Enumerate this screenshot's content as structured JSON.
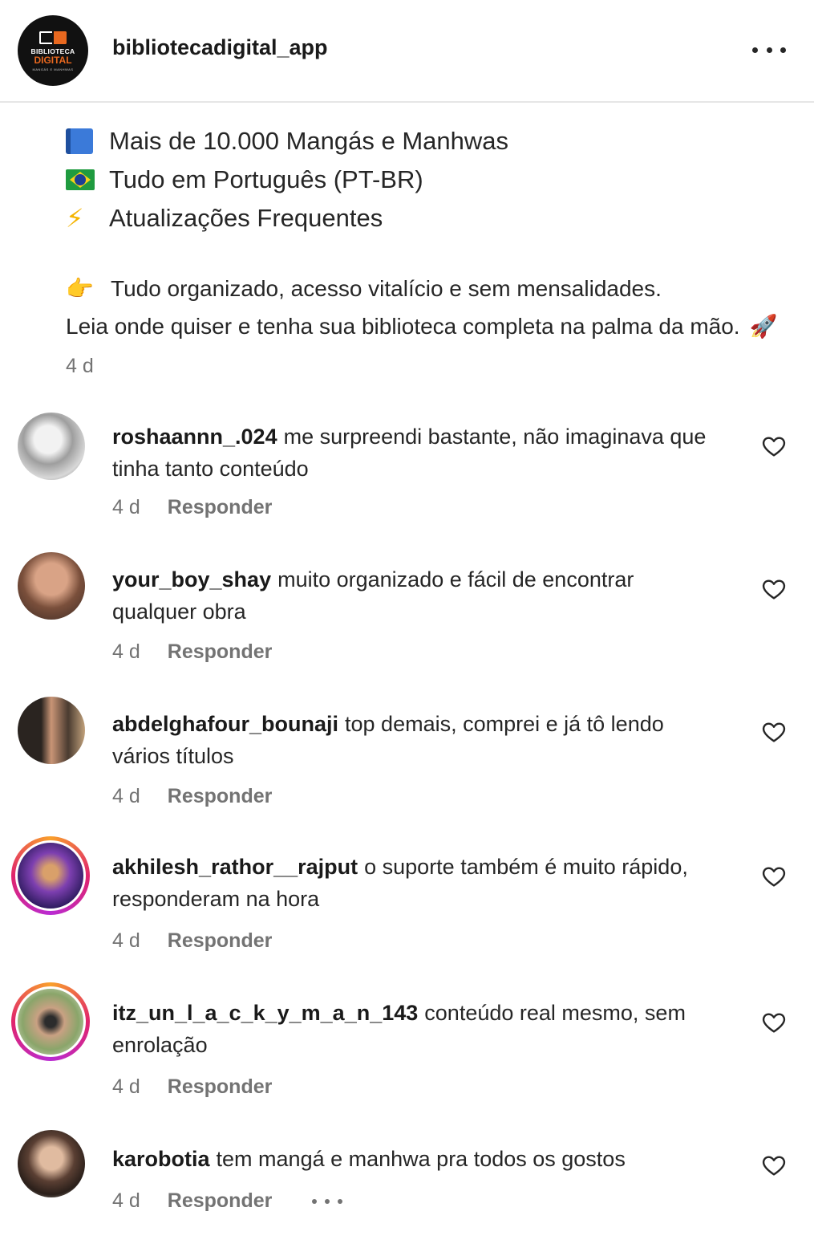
{
  "header": {
    "username": "bibliotecadigital_app",
    "logo": {
      "line1": "BIBLIOTECA",
      "line2": "DIGITAL",
      "line3": "MANGÁS E MANHWAS"
    },
    "more_icon": "more-horizontal-icon"
  },
  "caption": {
    "lines": [
      {
        "icon": "blue-book-emoji",
        "text": "Mais de 10.000 Mangás e Manhwas"
      },
      {
        "icon": "brazil-flag-emoji",
        "text": "Tudo em Português (PT-BR)"
      },
      {
        "icon": "lightning-emoji",
        "text": "Atualizações Frequentes"
      }
    ],
    "paragraph": [
      {
        "icon": "pointing-hand-emoji",
        "text": "Tudo organizado, acesso vitalício e sem mensalidades."
      },
      {
        "text": "Leia onde quiser e tenha sua biblioteca completa na palma da mão.",
        "icon": "rocket-emoji"
      }
    ],
    "date": "4 d"
  },
  "comments": [
    {
      "username": "roshaannn_.024",
      "text": "me surpreendi bastante, não imaginava que tinha tanto conteúdo",
      "date": "4 d",
      "reply": "Responder",
      "story_ring": false,
      "avatar_color": "#bdbdbd"
    },
    {
      "username": "your_boy_shay",
      "text": "muito organizado e fácil de encontrar qualquer obra",
      "date": "4 d",
      "reply": "Responder",
      "story_ring": false,
      "avatar_color": "#8a5a44"
    },
    {
      "username": "abdelghafour_bounaji",
      "text": "top demais, comprei e já tô lendo vários títulos",
      "date": "4 d",
      "reply": "Responder",
      "story_ring": false,
      "avatar_color": "#4a3d33"
    },
    {
      "username": "akhilesh_rathor__rajput",
      "text": "o suporte também é muito rápido, responderam na hora",
      "date": "4 d",
      "reply": "Responder",
      "story_ring": true,
      "avatar_color": "#4b2e83"
    },
    {
      "username": "itz_un_l_a_c_k_y_m_a_n_143",
      "text": "conteúdo real mesmo, sem enrolação",
      "date": "4 d",
      "reply": "Responder",
      "story_ring": true,
      "avatar_color": "#7a8f5a"
    },
    {
      "username": "karobotia",
      "text": "tem mangá e manhwa pra todos os gostos",
      "date": "4 d",
      "reply": "Responder",
      "story_ring": false,
      "avatar_color": "#6e5447"
    }
  ],
  "icons": {
    "like": "heart-outline-icon",
    "options": "more-dots-icon"
  }
}
